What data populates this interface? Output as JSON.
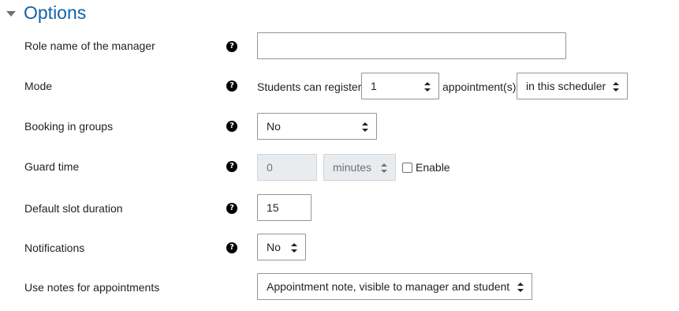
{
  "section": {
    "title": "Options"
  },
  "rows": {
    "role_name": {
      "label": "Role name of the manager",
      "value": ""
    },
    "mode": {
      "label": "Mode",
      "prefix": "Students can register",
      "count_value": "1",
      "middle": "appointment(s)",
      "scope_value": "in this scheduler"
    },
    "booking_groups": {
      "label": "Booking in groups",
      "value": "No"
    },
    "guard_time": {
      "label": "Guard time",
      "value": "0",
      "unit": "minutes",
      "enable_label": "Enable",
      "enabled": false
    },
    "slot_duration": {
      "label": "Default slot duration",
      "value": "15"
    },
    "notifications": {
      "label": "Notifications",
      "value": "No"
    },
    "notes": {
      "label": "Use notes for appointments",
      "value": "Appointment note, visible to manager and student"
    }
  },
  "icons": {
    "help": "question-circle-icon",
    "collapse": "caret-down-icon",
    "select_arrows": "sort-icon"
  },
  "colors": {
    "title": "#1262a8",
    "border": "#8f959e",
    "disabled_bg": "#e9ecef",
    "text": "#1d2125"
  }
}
